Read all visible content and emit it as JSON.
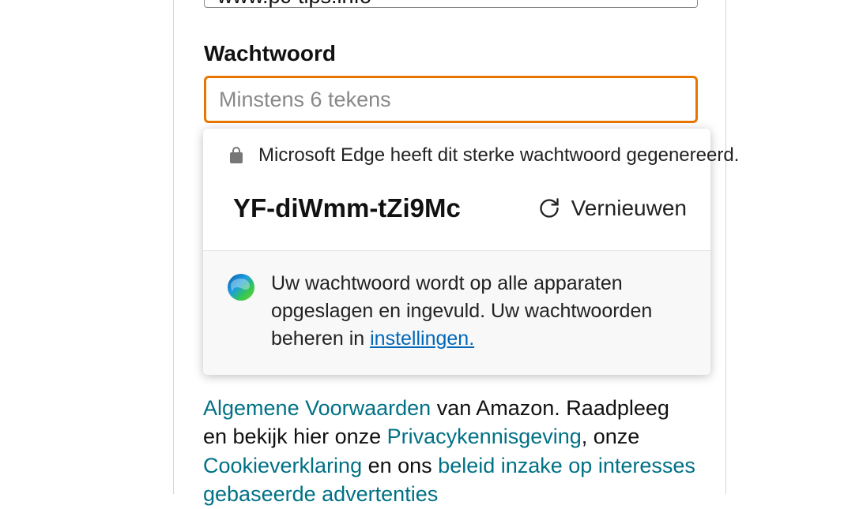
{
  "form": {
    "url_value": "www.pc-tips.info",
    "password_label": "Wachtwoord",
    "password_placeholder": "Minstens 6 tekens"
  },
  "popup": {
    "top_message": "Microsoft Edge heeft dit sterke wachtwoord gegenereerd.",
    "generated_password": "YF-diWmm-tZi9Mc",
    "refresh_label": "Vernieuwen",
    "bottom_text_before": "Uw wachtwoord wordt op alle apparaten opgeslagen en ingevuld. Uw wachtwoorden beheren in  ",
    "settings_link_label": "instellingen."
  },
  "legal": {
    "alg_voorwaarden": "Algemene Voorwaarden",
    "after_alg": " van Amazon. Raadpleeg en bekijk hier onze ",
    "privacy": "Privacykennisgeving",
    "after_privacy": ", onze ",
    "cookie": "Cookieverklaring",
    "after_cookie": " en ons ",
    "beleid": "beleid inzake op interesses gebaseerde advertenties"
  }
}
